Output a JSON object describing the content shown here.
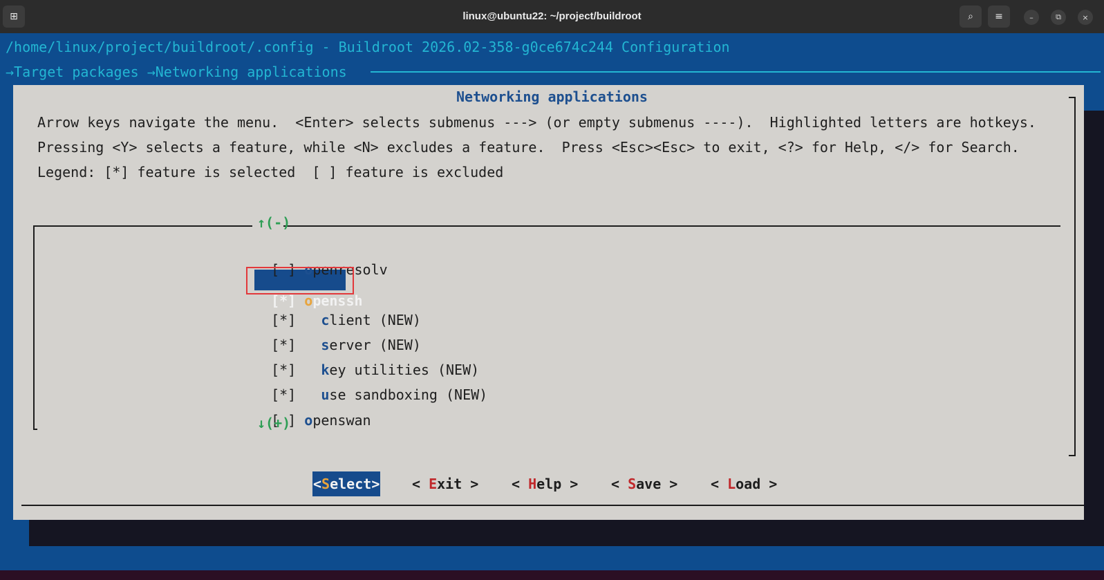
{
  "window": {
    "title": "linux@ubuntu22: ~/project/buildroot",
    "new_tab_icon": "new-tab-icon",
    "search_icon": "search-icon",
    "menu_icon": "hamburger-icon",
    "minimize": "–",
    "restore": "⧉",
    "close": "×"
  },
  "terminal": {
    "config_path": "/home/linux/project/buildroot/.config - Buildroot 2026.02-358-g0ce674c244 Configuration",
    "breadcrumb": "→Target packages →Networking applications"
  },
  "dialog": {
    "title": "Networking applications",
    "help_lines": [
      "Arrow keys navigate the menu.  <Enter> selects submenus ---> (or empty submenus ----).  Highlighted letters are hotkeys.",
      "Pressing <Y> selects a feature, while <N> excludes a feature.  Press <Esc><Esc> to exit, <?> for Help, </> for Search.",
      "Legend: [*] feature is selected  [ ] feature is excluded"
    ],
    "scroll_up": "↑(-)",
    "scroll_down": "↓(+)",
    "items": [
      {
        "box": "[ ] ",
        "indent": "",
        "hotkey": "o",
        "rest": "penresolv"
      },
      {
        "box": "[*] ",
        "indent": "",
        "hotkey": "o",
        "rest": "penssh"
      },
      {
        "box": "[*] ",
        "indent": "  ",
        "hotkey": "c",
        "rest": "lient (NEW)"
      },
      {
        "box": "[*] ",
        "indent": "  ",
        "hotkey": "s",
        "rest": "erver (NEW)"
      },
      {
        "box": "[*] ",
        "indent": "  ",
        "hotkey": "k",
        "rest": "ey utilities (NEW)"
      },
      {
        "box": "[*] ",
        "indent": "  ",
        "hotkey": "u",
        "rest": "se sandboxing (NEW)"
      },
      {
        "box": "[ ] ",
        "indent": "",
        "hotkey": "o",
        "rest": "penswan"
      }
    ],
    "buttons": [
      {
        "pre": "<",
        "hotkey": "S",
        "rest": "elect",
        "post": ">"
      },
      {
        "pre": "< ",
        "hotkey": "E",
        "rest": "xit",
        "post": " >"
      },
      {
        "pre": "< ",
        "hotkey": "H",
        "rest": "elp",
        "post": " >"
      },
      {
        "pre": "< ",
        "hotkey": "S",
        "rest": "ave",
        "post": " >"
      },
      {
        "pre": "< ",
        "hotkey": "L",
        "rest": "oad",
        "post": " >"
      }
    ]
  },
  "colors": {
    "terminal_bg": "#0e4c8e",
    "dialog_bg": "#d4d2ce",
    "highlight": "#164b8c",
    "hotkey": "#1d4f8f",
    "button_hotkey": "#c0282b",
    "annotation": "#e2383b"
  }
}
